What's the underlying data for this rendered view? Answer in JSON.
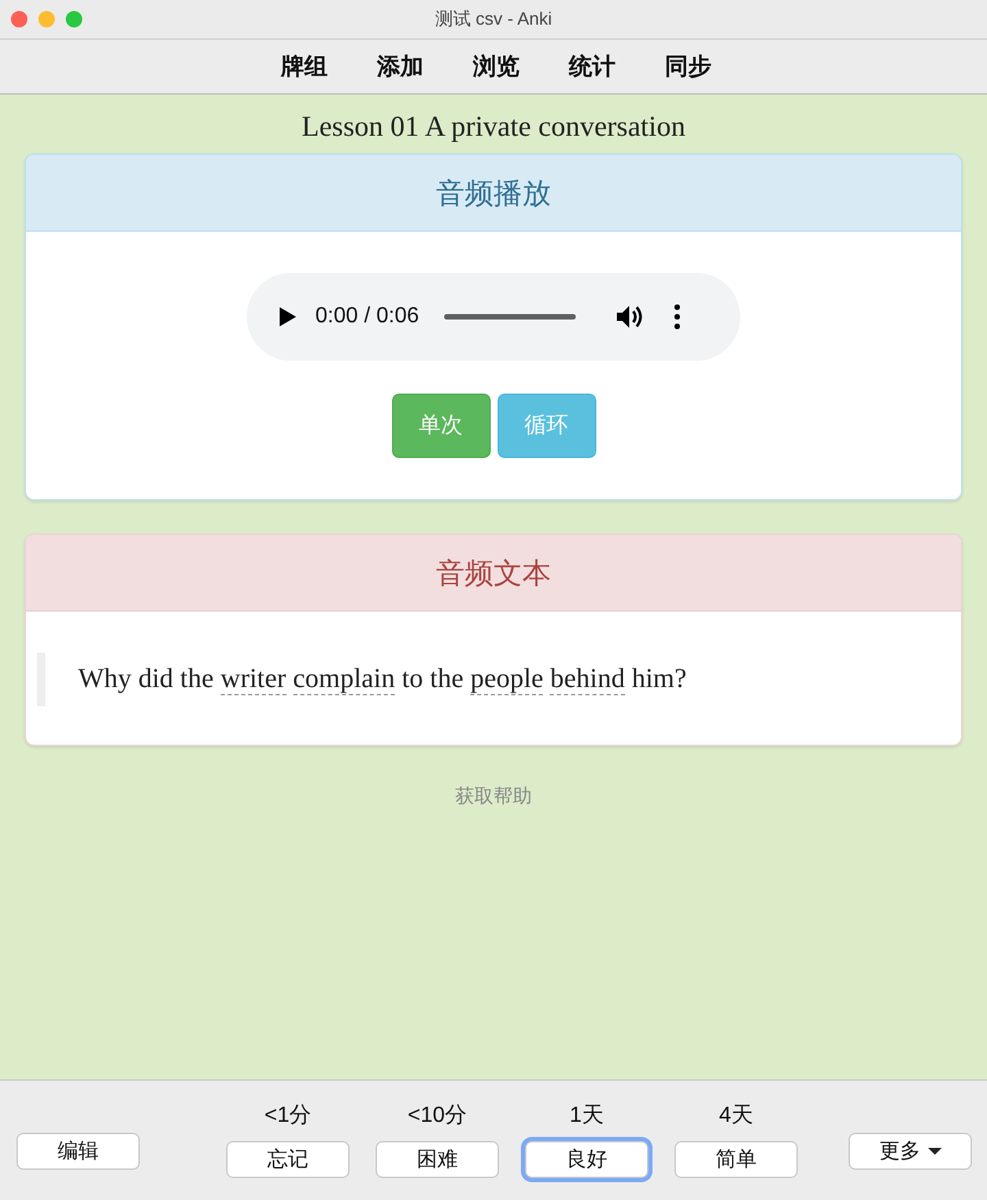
{
  "window": {
    "title": "测试 csv - Anki"
  },
  "toolbar": [
    "牌组",
    "添加",
    "浏览",
    "统计",
    "同步"
  ],
  "card": {
    "title": "Lesson 01 A private conversation",
    "audio_section": {
      "heading": "音频播放",
      "player": {
        "time": "0:00 / 0:06"
      },
      "buttons": [
        {
          "label": "单次",
          "kind": "once"
        },
        {
          "label": "循环",
          "kind": "loop"
        }
      ]
    },
    "text_section": {
      "heading": "音频文本",
      "sentence": [
        {
          "text": "Why did the ",
          "kind": "plain"
        },
        {
          "text": "writer complain",
          "kind": "vocab"
        },
        {
          "text": " to the ",
          "kind": "plain"
        },
        {
          "text": "people behind",
          "kind": "vocab"
        },
        {
          "text": " him?",
          "kind": "plain"
        }
      ]
    },
    "help_link": "获取帮助"
  },
  "bottom_bar": {
    "edit_button": "编辑",
    "answers": [
      {
        "interval": "<1分",
        "label": "忘记",
        "selected": false
      },
      {
        "interval": "<10分",
        "label": "困难",
        "selected": false
      },
      {
        "interval": "1天",
        "label": "良好",
        "selected": true
      },
      {
        "interval": "4天",
        "label": "简单",
        "selected": false
      }
    ],
    "more_button": "更多"
  }
}
